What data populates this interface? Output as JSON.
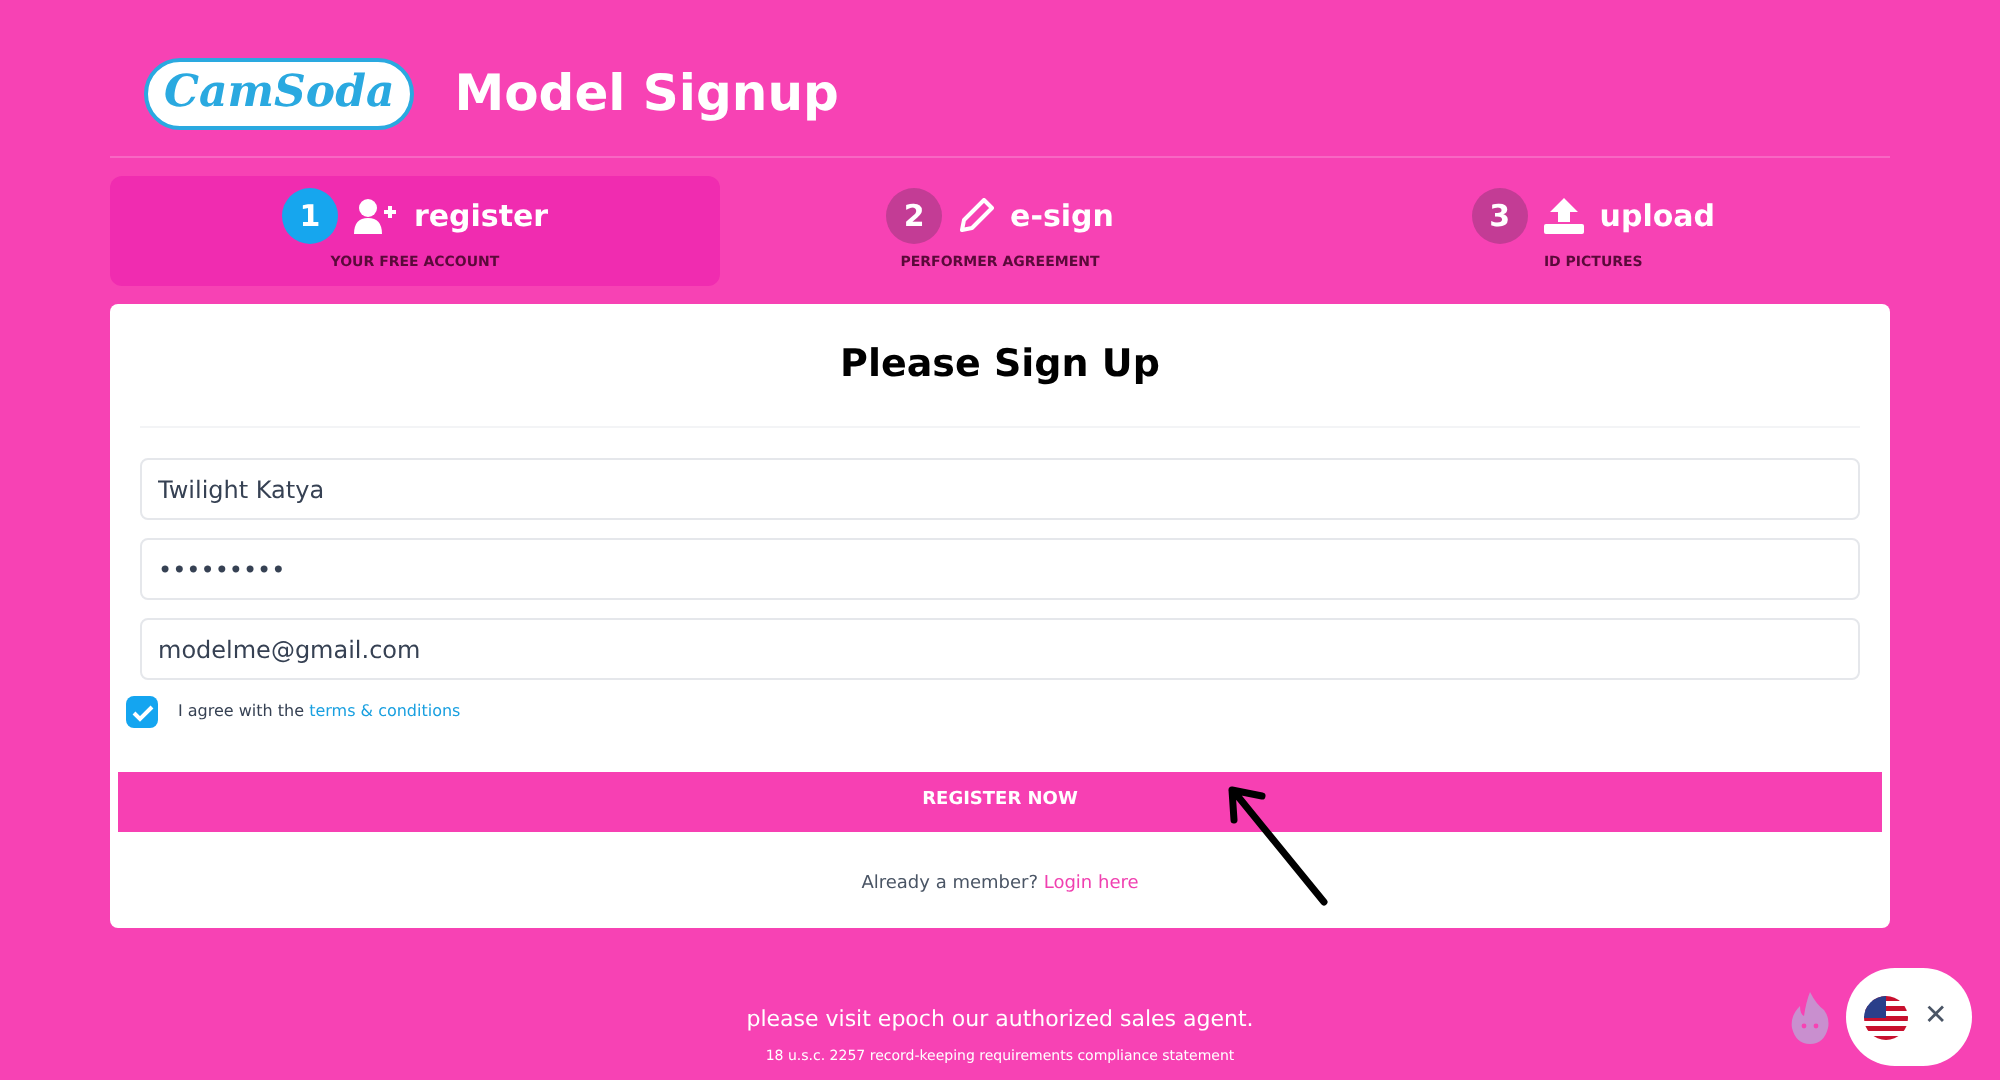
{
  "header": {
    "logo": "CamSoda",
    "title": "Model Signup"
  },
  "steps": [
    {
      "number": "1",
      "label": "register",
      "sublabel": "YOUR FREE ACCOUNT",
      "selected": true
    },
    {
      "number": "2",
      "label": "e-sign",
      "sublabel": "PERFORMER AGREEMENT",
      "selected": false
    },
    {
      "number": "3",
      "label": "upload",
      "sublabel": "ID PICTURES",
      "selected": false
    }
  ],
  "form": {
    "title": "Please Sign Up",
    "fields": [
      {
        "value": "Twilight Katya"
      },
      {
        "value": "•••••••••"
      },
      {
        "value": "modelme@gmail.com"
      }
    ],
    "agree": {
      "checked": true,
      "text": "I agree with the",
      "link": "terms & conditions"
    },
    "button": "REGISTER NOW",
    "login_prompt": "Already a member?",
    "login_link": "Login here"
  },
  "footer": {
    "line": "please visit epoch our authorized sales agent.",
    "note": "18 u.s.c. 2257 record-keeping requirements compliance statement"
  },
  "widget": {
    "close": "✕"
  }
}
